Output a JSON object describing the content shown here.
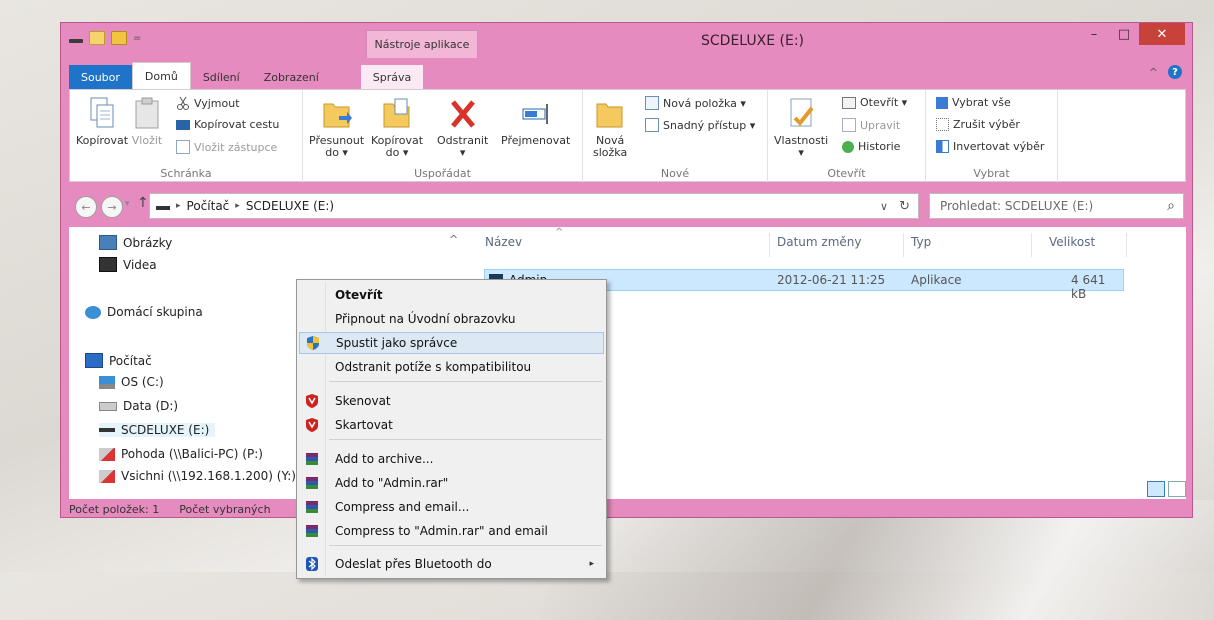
{
  "window": {
    "title": "SCDELUXE (E:)",
    "context_tab": "Nástroje aplikace",
    "qat_more": "=",
    "minimize": "–",
    "maximize": "□",
    "close": "✕"
  },
  "tabs": [
    "Soubor",
    "Domů",
    "Sdílení",
    "Zobrazení",
    "Správa"
  ],
  "help": {
    "collapse": "^",
    "help": "?"
  },
  "ribbon": {
    "clipboard": {
      "label": "Schránka",
      "copy": "Kopírovat",
      "paste": "Vložit",
      "cut": "Vyjmout",
      "copy_path": "Kopírovat cestu",
      "paste_shortcut": "Vložit zástupce"
    },
    "organize": {
      "label": "Uspořádat",
      "move_line1": "Přesunout",
      "move_line2": "do ▾",
      "copy_line1": "Kopírovat",
      "copy_line2": "do ▾",
      "delete": "Odstranit",
      "delete_arrow": "▾",
      "rename": "Přejmenovat"
    },
    "new": {
      "label": "Nové",
      "folder_line1": "Nová",
      "folder_line2": "složka",
      "new_item": "Nová položka ▾",
      "easy_access": "Snadný přístup ▾"
    },
    "open": {
      "label": "Otevřít",
      "properties": "Vlastnosti",
      "properties_arrow": "▾",
      "open": "Otevřít ▾",
      "edit": "Upravit",
      "history": "Historie"
    },
    "select": {
      "label": "Vybrat",
      "select_all": "Vybrat vše",
      "select_none": "Zrušit výběr",
      "invert": "Invertovat výběr"
    }
  },
  "address": {
    "back": "←",
    "forward": "→",
    "recent": "▾",
    "up": "↑",
    "sep1": "▸",
    "crumb1": "Počítač",
    "sep2": "▸",
    "crumb2": "SCDELUXE (E:)",
    "dropdown": "∨",
    "refresh": "↻",
    "search_placeholder": "Prohledat: SCDELUXE (E:)",
    "search_icon": "⌕"
  },
  "nav": {
    "collapse": "^",
    "items": [
      "Obrázky",
      "Videa",
      "Domácí skupina",
      "Počítač",
      "OS (C:)",
      "Data (D:)",
      "SCDELUXE (E:)",
      "Pohoda (\\\\Balici-PC) (P:)",
      "Vsichni (\\\\192.168.1.200) (Y:)"
    ]
  },
  "columns": {
    "sort_indicator": "^",
    "name": "Název",
    "date": "Datum změny",
    "type": "Typ",
    "size": "Velikost"
  },
  "files": [
    {
      "name": "Admin",
      "date": "2012-06-21 11:25",
      "type": "Aplikace",
      "size": "4 641 kB"
    }
  ],
  "status": {
    "count": "Počet položek: 1",
    "selected": "Počet vybraných"
  },
  "context_menu": {
    "items": [
      {
        "label": "Otevřít",
        "icon": "none"
      },
      {
        "label": "Připnout na Úvodní obrazovku",
        "icon": "none"
      },
      {
        "label": "Spustit jako správce",
        "icon": "uac-shield-icon"
      },
      {
        "label": "Odstranit potíže s kompatibilitou",
        "icon": "none"
      },
      {
        "label": "Skenovat",
        "icon": "mcafee-icon"
      },
      {
        "label": "Skartovat",
        "icon": "mcafee-icon"
      },
      {
        "label": "Add to archive...",
        "icon": "winrar-icon"
      },
      {
        "label": "Add to \"Admin.rar\"",
        "icon": "winrar-icon"
      },
      {
        "label": "Compress and email...",
        "icon": "winrar-icon"
      },
      {
        "label": "Compress to \"Admin.rar\" and email",
        "icon": "winrar-icon"
      },
      {
        "label": "Odeslat přes Bluetooth do",
        "icon": "bluetooth-icon"
      }
    ],
    "submenu_arrow": "▸"
  },
  "colors": {
    "accent": "#e68bbf",
    "file_tab": "#1e74c8",
    "selection": "#cce8ff",
    "close": "#c7423b"
  }
}
